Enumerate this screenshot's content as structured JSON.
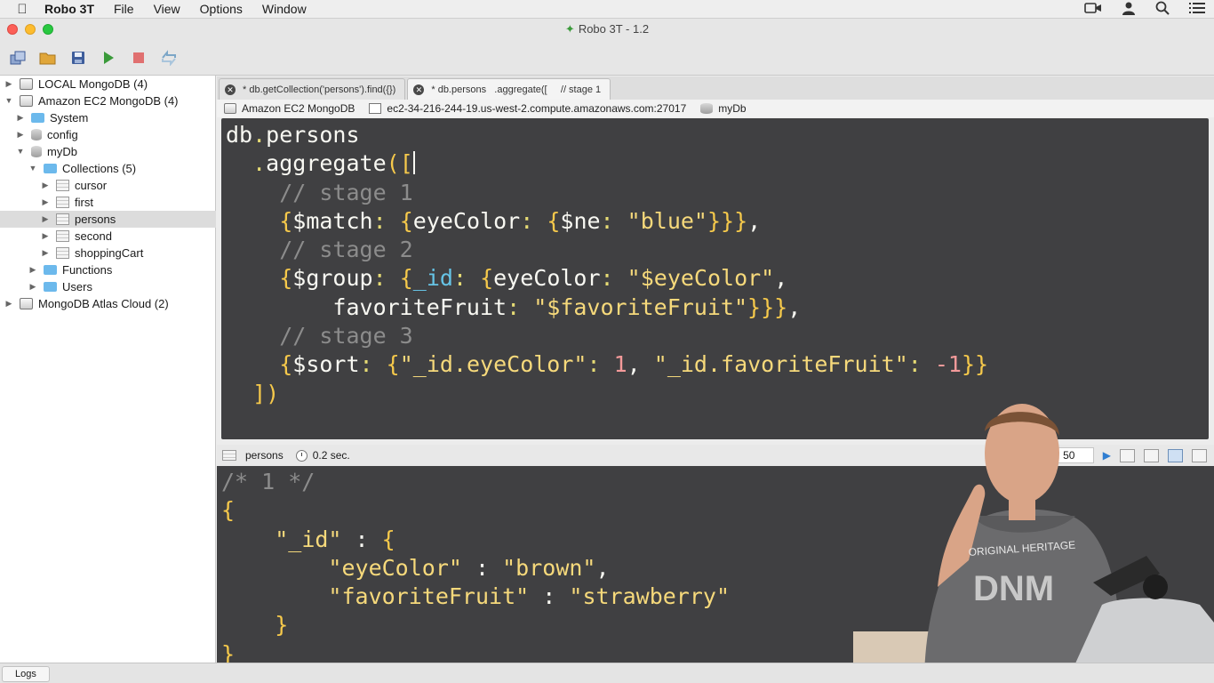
{
  "menubar": {
    "apple_icon": "apple-icon",
    "app_name": "Robo 3T",
    "items": [
      "File",
      "View",
      "Options",
      "Window"
    ],
    "right_icons": [
      "video-icon",
      "user-icon",
      "search-icon",
      "list-icon"
    ]
  },
  "window": {
    "title": "Robo 3T - 1.2"
  },
  "toolbar": {
    "buttons": [
      "connect-icon",
      "open-icon",
      "save-icon",
      "run-icon",
      "stop-icon",
      "refresh-icon"
    ]
  },
  "sidebar": {
    "items": [
      {
        "label": "LOCAL MongoDB (4)"
      },
      {
        "label": "Amazon EC2 MongoDB (4)"
      },
      {
        "label": "System"
      },
      {
        "label": "config"
      },
      {
        "label": "myDb"
      },
      {
        "label": "Collections (5)"
      },
      {
        "label": "cursor"
      },
      {
        "label": "first"
      },
      {
        "label": "persons"
      },
      {
        "label": "second"
      },
      {
        "label": "shoppingCart"
      },
      {
        "label": "Functions"
      },
      {
        "label": "Users"
      },
      {
        "label": "MongoDB Atlas Cloud (2)"
      }
    ]
  },
  "tabs": [
    {
      "label": "* db.getCollection('persons').find({})"
    },
    {
      "label": "* db.persons   .aggregate([     // stage 1"
    }
  ],
  "connection": {
    "server": "Amazon EC2 MongoDB",
    "host": "ec2-34-216-244-19.us-west-2.compute.amazonaws.com:27017",
    "database": "myDb"
  },
  "results": {
    "collection": "persons",
    "time": "0.2 sec.",
    "page_size": "50"
  },
  "logs": {
    "label": "Logs"
  },
  "colors": {
    "editor_bg": "#404042",
    "brace": "#f6c94b",
    "string": "#f6d97b",
    "comment": "#8c8c8c",
    "number": "#f49a9a"
  }
}
